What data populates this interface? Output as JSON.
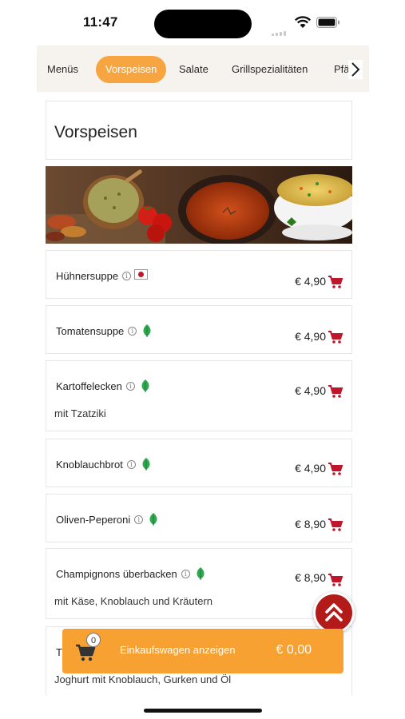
{
  "status_bar": {
    "time": "11:47"
  },
  "categories": [
    {
      "label": "Menüs",
      "active": false
    },
    {
      "label": "Vorspeisen",
      "active": true
    },
    {
      "label": "Salate",
      "active": false
    },
    {
      "label": "Grillspezialitäten",
      "active": false
    },
    {
      "label": "Pfä",
      "active": false
    }
  ],
  "section": {
    "title": "Vorspeisen"
  },
  "items": [
    {
      "name": "Hühnersuppe",
      "desc": "",
      "price": "€ 4,90",
      "badge": "jp-flag-icon"
    },
    {
      "name": "Tomatensuppe",
      "desc": "",
      "price": "€ 4,90",
      "badge": "leaf-icon"
    },
    {
      "name": "Kartoffelecken",
      "desc": "mit Tzatziki",
      "price": "€ 4,90",
      "badge": "leaf-icon"
    },
    {
      "name": "Knoblauchbrot",
      "desc": "",
      "price": "€ 4,90",
      "badge": "leaf-icon"
    },
    {
      "name": "Oliven-Peperoni",
      "desc": "",
      "price": "€ 8,90",
      "badge": "leaf-icon"
    },
    {
      "name": "Champignons überbacken",
      "desc": "mit Käse, Knoblauch und Kräutern",
      "price": "€ 8,90",
      "badge": "leaf-icon"
    },
    {
      "name": "T",
      "desc": "Joghurt mit Knoblauch, Gurken und Öl",
      "price": "",
      "badge": ""
    }
  ],
  "cart": {
    "count": "0",
    "label": "Einkaufswagen anzeigen",
    "total": "€ 0,00"
  },
  "colors": {
    "accent": "#f7a541",
    "cart_bar": "#f7a133",
    "cart_icon": "#c0162c",
    "scroll_button": "#b31b1b",
    "leaf": "#2fa84f"
  }
}
